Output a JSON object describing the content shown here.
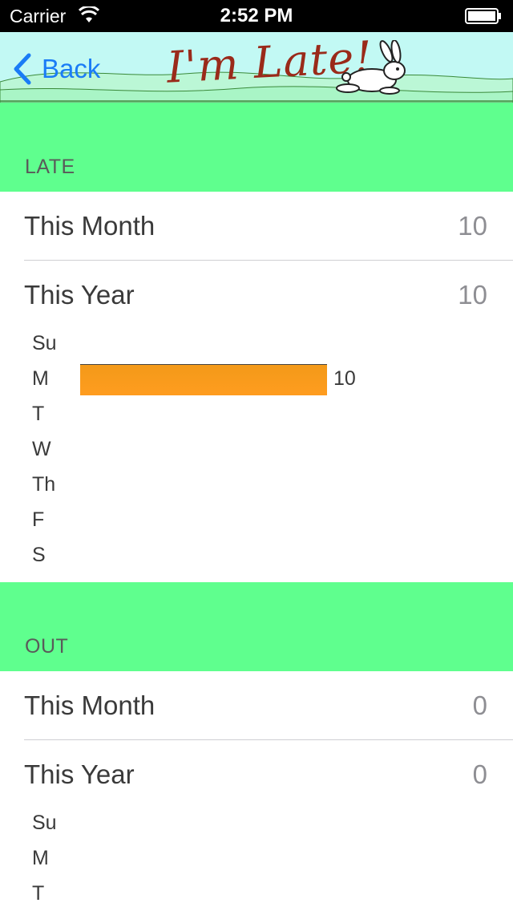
{
  "status_bar": {
    "carrier": "Carrier",
    "time": "2:52 PM",
    "wifi_icon": "wifi-icon",
    "battery_icon": "battery-icon"
  },
  "nav": {
    "back_label": "Back",
    "title": "I'm Late!",
    "back_icon": "chevron-left-icon",
    "rabbit_image": "rabbit-illustration"
  },
  "colors": {
    "accent": "#1a7cf6",
    "section_bg": "#5fff8e",
    "bar": "#ff9c1f",
    "nav_bg": "#c2f9f4",
    "title": "#9a2a1a"
  },
  "sections": [
    {
      "header": "LATE",
      "this_month_label": "This Month",
      "this_month_value": "10",
      "this_year_label": "This Year",
      "this_year_value": "10",
      "weekdays": [
        {
          "day": "Su",
          "count": 0,
          "count_label": ""
        },
        {
          "day": "M",
          "count": 10,
          "count_label": "10"
        },
        {
          "day": "T",
          "count": 0,
          "count_label": ""
        },
        {
          "day": "W",
          "count": 0,
          "count_label": ""
        },
        {
          "day": "Th",
          "count": 0,
          "count_label": ""
        },
        {
          "day": "F",
          "count": 0,
          "count_label": ""
        },
        {
          "day": "S",
          "count": 0,
          "count_label": ""
        }
      ]
    },
    {
      "header": "OUT",
      "this_month_label": "This Month",
      "this_month_value": "0",
      "this_year_label": "This Year",
      "this_year_value": "0",
      "weekdays": [
        {
          "day": "Su",
          "count": 0,
          "count_label": ""
        },
        {
          "day": "M",
          "count": 0,
          "count_label": ""
        },
        {
          "day": "T",
          "count": 0,
          "count_label": ""
        }
      ]
    }
  ]
}
